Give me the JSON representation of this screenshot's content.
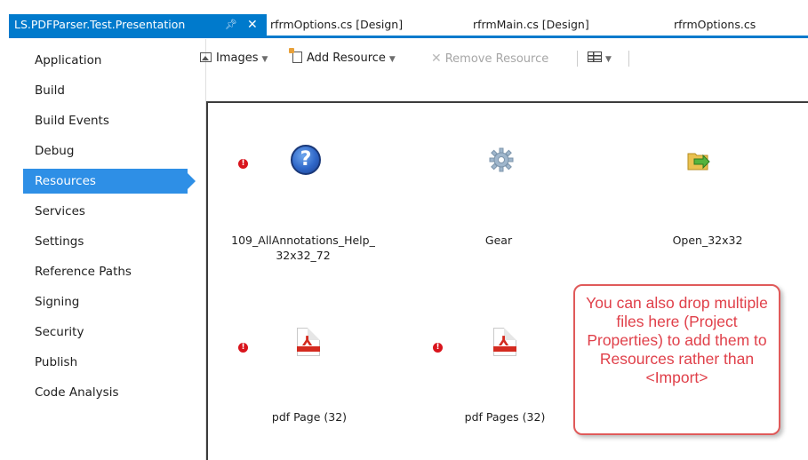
{
  "tabs": [
    {
      "label": "LS.PDFParser.Test.Presentation",
      "active": true
    },
    {
      "label": "rfrmOptions.cs [Design]",
      "active": false
    },
    {
      "label": "rfrmMain.cs [Design]",
      "active": false
    },
    {
      "label": "rfrmOptions.cs",
      "active": false
    }
  ],
  "tab_icons": {
    "pin": "pin-icon",
    "close": "close-icon"
  },
  "sidebar": {
    "items": [
      {
        "label": "Application"
      },
      {
        "label": "Build"
      },
      {
        "label": "Build Events"
      },
      {
        "label": "Debug"
      },
      {
        "label": "Resources",
        "selected": true
      },
      {
        "label": "Services"
      },
      {
        "label": "Settings"
      },
      {
        "label": "Reference Paths"
      },
      {
        "label": "Signing"
      },
      {
        "label": "Security"
      },
      {
        "label": "Publish"
      },
      {
        "label": "Code Analysis"
      }
    ]
  },
  "toolbar": {
    "images_label": "Images",
    "add_resource_label": "Add Resource",
    "remove_resource_label": "Remove Resource",
    "view_icon": "grid-view-icon"
  },
  "resources": [
    {
      "name": "109_AllAnnotations_Help_\n32x32_72",
      "icon": "help-icon",
      "error": true
    },
    {
      "name": "Gear",
      "icon": "gear-icon",
      "error": false
    },
    {
      "name": "Open_32x32",
      "icon": "folder-icon",
      "error": false
    },
    {
      "name": "pdf Page (32)",
      "icon": "pdf-icon",
      "error": true
    },
    {
      "name": "pdf Pages (32)",
      "icon": "pdf-icon",
      "error": true
    }
  ],
  "callout": {
    "text": "You can also drop multiple files here (Project Properties) to add them to Resources rather than <Import>"
  },
  "colors": {
    "accent": "#007acc",
    "selected_nav": "#2e8fe6",
    "error": "#d9141c",
    "callout_text": "#e0404a",
    "callout_border": "#e05a5a"
  }
}
